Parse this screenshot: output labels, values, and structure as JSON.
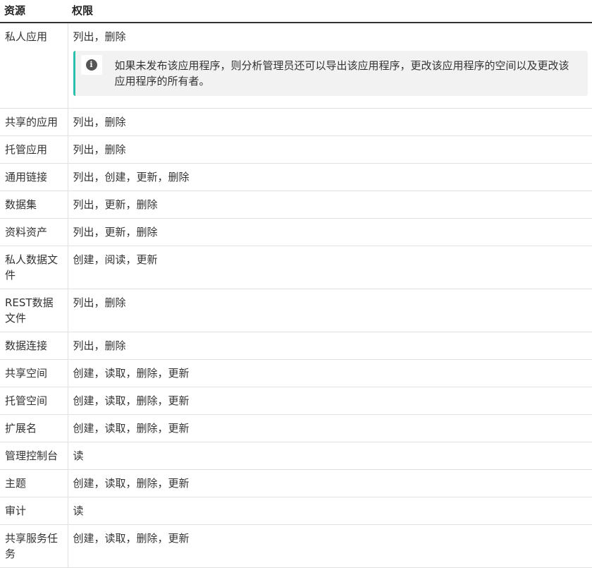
{
  "table": {
    "headers": {
      "resource": "资源",
      "permission": "权限"
    },
    "rows": [
      {
        "resource": "私人应用",
        "permission": "列出，删除",
        "note": "如果未发布该应用程序，则分析管理员还可以导出该应用程序，更改该应用程序的空间以及更改该应用程序的所有者。"
      },
      {
        "resource": "共享的应用",
        "permission": "列出，删除"
      },
      {
        "resource": "托管应用",
        "permission": "列出，删除"
      },
      {
        "resource": "通用链接",
        "permission": "列出，创建，更新，删除"
      },
      {
        "resource": "数据集",
        "permission": "列出，更新，删除"
      },
      {
        "resource": "资料资产",
        "permission": "列出，更新，删除"
      },
      {
        "resource": "私人数据文件",
        "permission": "创建，阅读，更新"
      },
      {
        "resource": "REST数据文件",
        "permission": "列出，删除"
      },
      {
        "resource": "数据连接",
        "permission": "列出，删除"
      },
      {
        "resource": "共享空间",
        "permission": "创建，读取，删除，更新"
      },
      {
        "resource": "托管空间",
        "permission": "创建，读取，删除，更新"
      },
      {
        "resource": "扩展名",
        "permission": "创建，读取，删除，更新"
      },
      {
        "resource": "管理控制台",
        "permission": "读"
      },
      {
        "resource": "主题",
        "permission": "创建，读取，删除，更新"
      },
      {
        "resource": "审计",
        "permission": "读"
      },
      {
        "resource": "共享服务任务",
        "permission": "创建，读取，删除，更新"
      }
    ]
  },
  "icons": {
    "note_icon": "info-circle-icon"
  }
}
